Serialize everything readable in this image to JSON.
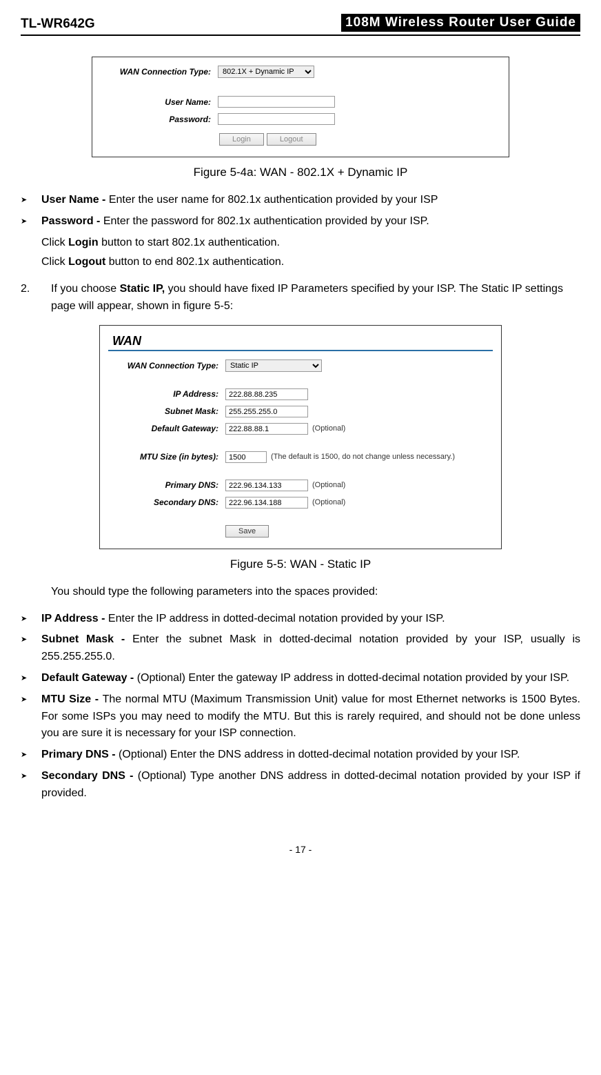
{
  "header": {
    "model": "TL-WR642G",
    "title": "108M Wireless Router User Guide"
  },
  "fig1": {
    "conn_label": "WAN Connection Type:",
    "conn_value": "802.1X + Dynamic IP",
    "user_label": "User Name:",
    "pass_label": "Password:",
    "login_btn": "Login",
    "logout_btn": "Logout",
    "caption": "Figure 5-4a: WAN - 802.1X + Dynamic IP"
  },
  "bullets1": {
    "user": {
      "b": "User Name - ",
      "t": "Enter the user name for 802.1x authentication provided by your ISP"
    },
    "pass": {
      "b": "Password - ",
      "t": "Enter the password for 802.1x authentication provided by your ISP."
    }
  },
  "click_lines": {
    "login_pre": "Click ",
    "login_b": "Login",
    "login_post": " button to start 802.1x authentication.",
    "logout_pre": "Click ",
    "logout_b": "Logout",
    "logout_post": " button to end 802.1x authentication."
  },
  "step2": {
    "num": "2.",
    "pre": "If you choose ",
    "b": "Static IP,",
    "post": " you should have fixed IP Parameters specified by your ISP. The Static IP settings page will appear, shown in figure 5-5:"
  },
  "fig2": {
    "wan": "WAN",
    "conn_label": "WAN Connection Type:",
    "conn_value": "Static IP",
    "ip_label": "IP Address:",
    "ip_val": "222.88.88.235",
    "sm_label": "Subnet Mask:",
    "sm_val": "255.255.255.0",
    "gw_label": "Default Gateway:",
    "gw_val": "222.88.88.1",
    "gw_opt": "(Optional)",
    "mtu_label": "MTU Size (in bytes):",
    "mtu_val": "1500",
    "mtu_note": "(The default is 1500, do not change unless necessary.)",
    "pdns_label": "Primary DNS:",
    "pdns_val": "222.96.134.133",
    "pdns_opt": "(Optional)",
    "sdns_label": "Secondary DNS:",
    "sdns_val": "222.96.134.188",
    "sdns_opt": "(Optional)",
    "save_btn": "Save",
    "caption": "Figure 5-5: WAN - Static IP"
  },
  "intro2": "You should type the following parameters into the spaces provided:",
  "bullets2": {
    "ip": {
      "b": "IP Address - ",
      "t": "Enter the IP address in dotted-decimal notation provided by your ISP."
    },
    "sm": {
      "b": "Subnet Mask - ",
      "t": "Enter the subnet Mask in dotted-decimal notation provided by your ISP, usually is 255.255.255.0."
    },
    "gw": {
      "b": "Default Gateway - ",
      "t": "(Optional) Enter the gateway IP address in dotted-decimal notation provided by your ISP."
    },
    "mtu": {
      "b": "MTU Size - ",
      "t": "The normal MTU (Maximum Transmission Unit) value for most Ethernet networks is 1500 Bytes. For some ISPs you may need to modify the MTU. But this is rarely required, and should not be done unless you are sure it is necessary for your ISP connection."
    },
    "pdns": {
      "b": "Primary DNS - ",
      "t": "(Optional) Enter the DNS address in dotted-decimal notation provided by your ISP."
    },
    "sdns": {
      "b": "Secondary DNS - ",
      "t": "(Optional) Type another DNS address in dotted-decimal notation provided by your ISP if provided."
    }
  },
  "page_number": "- 17 -"
}
